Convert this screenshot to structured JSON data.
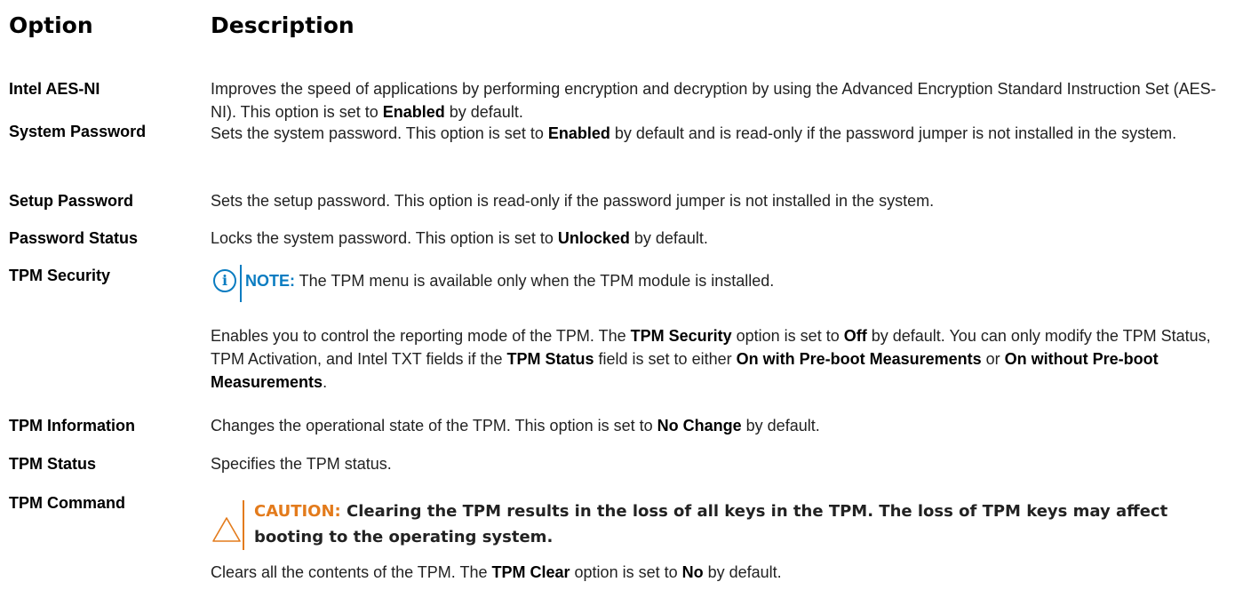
{
  "header": {
    "option": "Option",
    "description": "Description"
  },
  "rows": [
    {
      "option": "Intel AES-NI",
      "description": [
        {
          "t": "Improves the speed of applications by performing encryption and decryption by using the Advanced Encryption Standard Instruction Set (AES-NI). This option is set to ",
          "b": false
        },
        {
          "t": "Enabled",
          "b": true
        },
        {
          "t": " by default.",
          "b": false
        }
      ]
    },
    {
      "option": "System Password",
      "description": [
        {
          "t": "Sets the system password. This option is set to ",
          "b": false
        },
        {
          "t": "Enabled",
          "b": true
        },
        {
          "t": " by default and is read-only if the password jumper is not installed in the system.",
          "b": false
        }
      ]
    },
    {
      "option": "Setup Password",
      "description": [
        {
          "t": "Sets the setup password. This option is read-only if the password jumper is not installed in the system.",
          "b": false
        }
      ]
    },
    {
      "option": "Password Status",
      "description": [
        {
          "t": "Locks the system password. This option is set to ",
          "b": false
        },
        {
          "t": "Unlocked",
          "b": true
        },
        {
          "t": " by default.",
          "b": false
        }
      ]
    },
    {
      "option": "TPM Security",
      "note": {
        "label": "NOTE:",
        "text": " The TPM menu is available only when the TPM module is installed."
      },
      "description": [
        {
          "t": "Enables you to control the reporting mode of the TPM. The ",
          "b": false
        },
        {
          "t": "TPM Security",
          "b": true
        },
        {
          "t": " option is set to ",
          "b": false
        },
        {
          "t": "Off",
          "b": true
        },
        {
          "t": " by default. You can only modify the TPM Status, TPM Activation, and Intel TXT fields if the ",
          "b": false
        },
        {
          "t": "TPM Status",
          "b": true
        },
        {
          "t": " field is set to either ",
          "b": false
        },
        {
          "t": "On with Pre-boot Measurements",
          "b": true
        },
        {
          "t": " or ",
          "b": false
        },
        {
          "t": "On without Pre-boot Measurements",
          "b": true
        },
        {
          "t": ".",
          "b": false
        }
      ]
    },
    {
      "option": "TPM Information",
      "description": [
        {
          "t": "Changes the operational state of the TPM. This option is set to ",
          "b": false
        },
        {
          "t": "No Change",
          "b": true
        },
        {
          "t": " by default.",
          "b": false
        }
      ]
    },
    {
      "option": "TPM Status",
      "description": [
        {
          "t": "Specifies the TPM status.",
          "b": false
        }
      ]
    },
    {
      "option": "TPM Command",
      "caution": {
        "label": "CAUTION:",
        "text": " Clearing the TPM results in the loss of all keys in the TPM. The loss of TPM keys may affect booting to the operating system."
      },
      "description": [
        {
          "t": "Clears all the contents of the TPM. The ",
          "b": false
        },
        {
          "t": "TPM Clear",
          "b": true
        },
        {
          "t": " option is set to ",
          "b": false
        },
        {
          "t": "No",
          "b": true
        },
        {
          "t": " by default.",
          "b": false
        }
      ]
    }
  ],
  "colors": {
    "note": "#0a7cc1",
    "caution": "#e37b1c"
  },
  "icons": {
    "note": "info-icon",
    "caution": "caution-triangle-icon"
  }
}
